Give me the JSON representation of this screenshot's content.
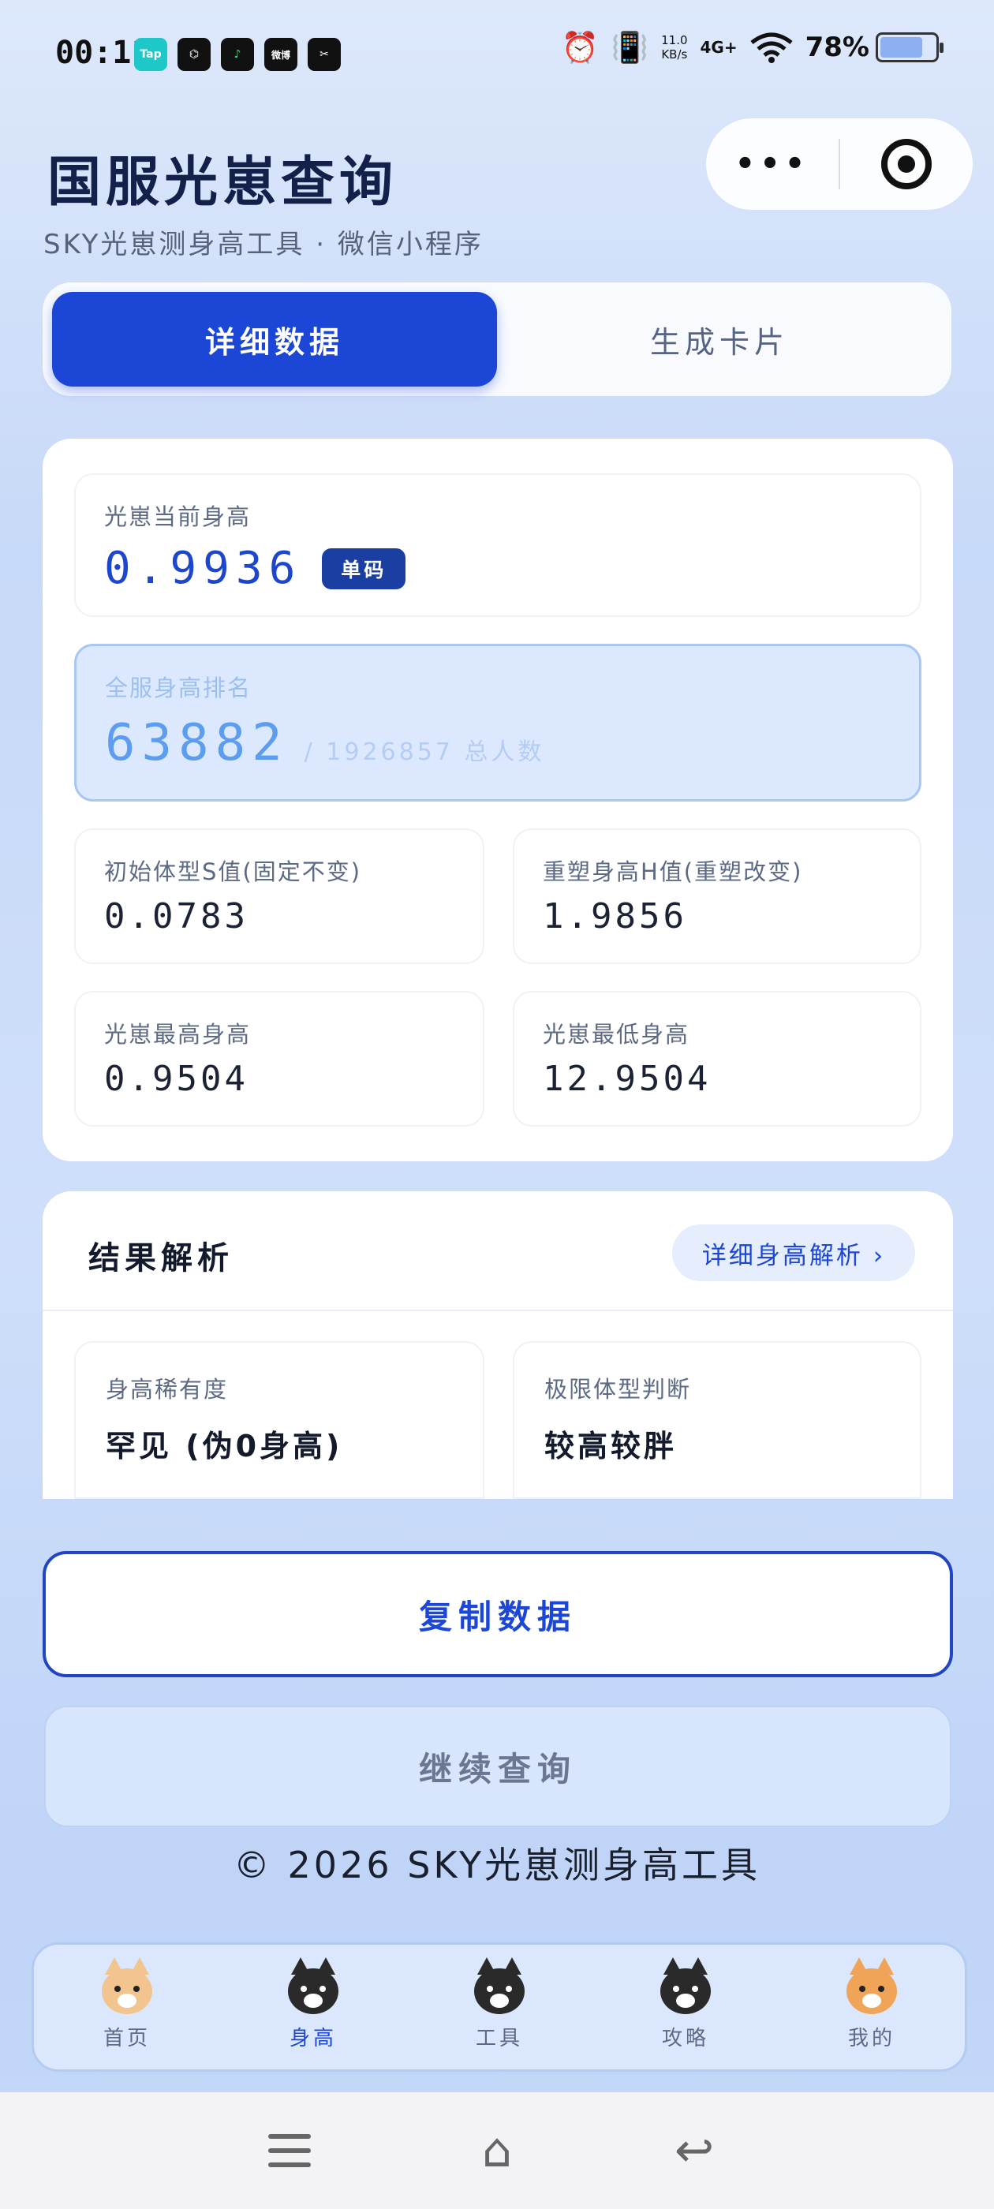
{
  "status_bar": {
    "time": "00:11",
    "apps": [
      "Tap",
      "⌬",
      "♪",
      "微博",
      "✂"
    ],
    "alarm_icon": "⏰",
    "vibrate_icon": "📳",
    "speed_value": "11.0",
    "speed_unit": "KB/s",
    "network": "4G+",
    "wifi_icon": "wifi-icon",
    "battery": "78%",
    "battery_level": 0.78
  },
  "header": {
    "title": "国服光崽查询",
    "subtitle": "SKY光崽测身高工具 · 微信小程序",
    "more_label": "•••"
  },
  "tabs": [
    {
      "label": "详细数据",
      "active": true
    },
    {
      "label": "生成卡片",
      "active": false
    }
  ],
  "height": {
    "label": "光崽当前身高",
    "value": "0.9936",
    "badge": "单码"
  },
  "rank": {
    "label": "全服身高排名",
    "value": "63882",
    "total": "/ 1926857 总人数"
  },
  "stats": {
    "s_label": "初始体型S值(固定不变)",
    "s_value": "0.0783",
    "h_label": "重塑身高H值(重塑改变)",
    "h_value": "1.9856",
    "max_label": "光崽最高身高",
    "max_value": "0.9504",
    "min_label": "光崽最低身高",
    "min_value": "12.9504"
  },
  "analysis": {
    "title": "结果解析",
    "link": "详细身高解析 ›",
    "rarity_label": "身高稀有度",
    "rarity_value": "罕见 (伪0身高)",
    "body_label": "极限体型判断",
    "body_value": "较高较胖"
  },
  "buttons": {
    "copy": "复制数据",
    "continue": "继续查询"
  },
  "copyright": "© 2026 SKY光崽测身高工具",
  "nav": [
    {
      "label": "首页",
      "color": "#f2c48f",
      "active": false
    },
    {
      "label": "身高",
      "color": "#2a2a2a",
      "active": true
    },
    {
      "label": "工具",
      "color": "#2a2a2a",
      "active": false
    },
    {
      "label": "攻略",
      "color": "#2a2a2a",
      "active": false
    },
    {
      "label": "我的",
      "color": "#f0a458",
      "active": false
    }
  ],
  "system_nav": {
    "home_glyph": "⌂",
    "back_glyph": "↩"
  }
}
